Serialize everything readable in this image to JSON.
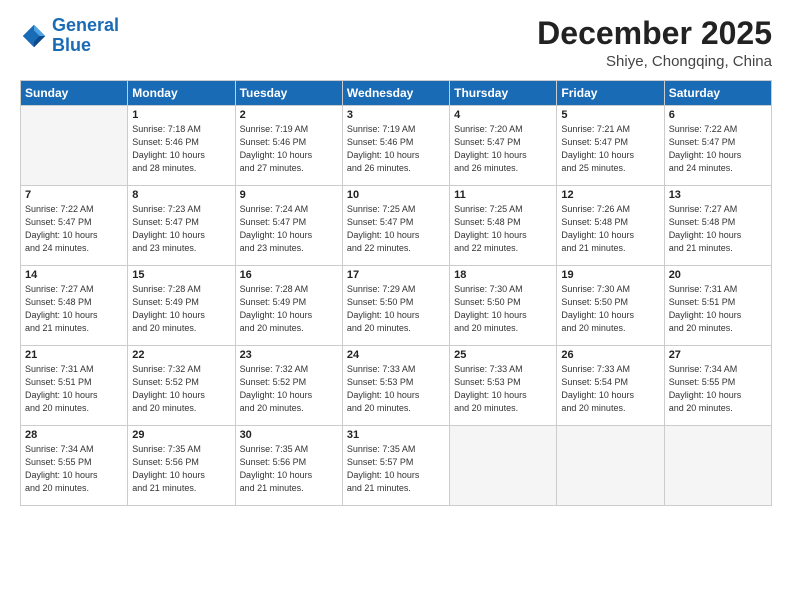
{
  "header": {
    "logo_line1": "General",
    "logo_line2": "Blue",
    "month": "December 2025",
    "location": "Shiye, Chongqing, China"
  },
  "days_of_week": [
    "Sunday",
    "Monday",
    "Tuesday",
    "Wednesday",
    "Thursday",
    "Friday",
    "Saturday"
  ],
  "weeks": [
    [
      {
        "day": "",
        "info": ""
      },
      {
        "day": "1",
        "info": "Sunrise: 7:18 AM\nSunset: 5:46 PM\nDaylight: 10 hours\nand 28 minutes."
      },
      {
        "day": "2",
        "info": "Sunrise: 7:19 AM\nSunset: 5:46 PM\nDaylight: 10 hours\nand 27 minutes."
      },
      {
        "day": "3",
        "info": "Sunrise: 7:19 AM\nSunset: 5:46 PM\nDaylight: 10 hours\nand 26 minutes."
      },
      {
        "day": "4",
        "info": "Sunrise: 7:20 AM\nSunset: 5:47 PM\nDaylight: 10 hours\nand 26 minutes."
      },
      {
        "day": "5",
        "info": "Sunrise: 7:21 AM\nSunset: 5:47 PM\nDaylight: 10 hours\nand 25 minutes."
      },
      {
        "day": "6",
        "info": "Sunrise: 7:22 AM\nSunset: 5:47 PM\nDaylight: 10 hours\nand 24 minutes."
      }
    ],
    [
      {
        "day": "7",
        "info": "Sunrise: 7:22 AM\nSunset: 5:47 PM\nDaylight: 10 hours\nand 24 minutes."
      },
      {
        "day": "8",
        "info": "Sunrise: 7:23 AM\nSunset: 5:47 PM\nDaylight: 10 hours\nand 23 minutes."
      },
      {
        "day": "9",
        "info": "Sunrise: 7:24 AM\nSunset: 5:47 PM\nDaylight: 10 hours\nand 23 minutes."
      },
      {
        "day": "10",
        "info": "Sunrise: 7:25 AM\nSunset: 5:47 PM\nDaylight: 10 hours\nand 22 minutes."
      },
      {
        "day": "11",
        "info": "Sunrise: 7:25 AM\nSunset: 5:48 PM\nDaylight: 10 hours\nand 22 minutes."
      },
      {
        "day": "12",
        "info": "Sunrise: 7:26 AM\nSunset: 5:48 PM\nDaylight: 10 hours\nand 21 minutes."
      },
      {
        "day": "13",
        "info": "Sunrise: 7:27 AM\nSunset: 5:48 PM\nDaylight: 10 hours\nand 21 minutes."
      }
    ],
    [
      {
        "day": "14",
        "info": "Sunrise: 7:27 AM\nSunset: 5:48 PM\nDaylight: 10 hours\nand 21 minutes."
      },
      {
        "day": "15",
        "info": "Sunrise: 7:28 AM\nSunset: 5:49 PM\nDaylight: 10 hours\nand 20 minutes."
      },
      {
        "day": "16",
        "info": "Sunrise: 7:28 AM\nSunset: 5:49 PM\nDaylight: 10 hours\nand 20 minutes."
      },
      {
        "day": "17",
        "info": "Sunrise: 7:29 AM\nSunset: 5:50 PM\nDaylight: 10 hours\nand 20 minutes."
      },
      {
        "day": "18",
        "info": "Sunrise: 7:30 AM\nSunset: 5:50 PM\nDaylight: 10 hours\nand 20 minutes."
      },
      {
        "day": "19",
        "info": "Sunrise: 7:30 AM\nSunset: 5:50 PM\nDaylight: 10 hours\nand 20 minutes."
      },
      {
        "day": "20",
        "info": "Sunrise: 7:31 AM\nSunset: 5:51 PM\nDaylight: 10 hours\nand 20 minutes."
      }
    ],
    [
      {
        "day": "21",
        "info": "Sunrise: 7:31 AM\nSunset: 5:51 PM\nDaylight: 10 hours\nand 20 minutes."
      },
      {
        "day": "22",
        "info": "Sunrise: 7:32 AM\nSunset: 5:52 PM\nDaylight: 10 hours\nand 20 minutes."
      },
      {
        "day": "23",
        "info": "Sunrise: 7:32 AM\nSunset: 5:52 PM\nDaylight: 10 hours\nand 20 minutes."
      },
      {
        "day": "24",
        "info": "Sunrise: 7:33 AM\nSunset: 5:53 PM\nDaylight: 10 hours\nand 20 minutes."
      },
      {
        "day": "25",
        "info": "Sunrise: 7:33 AM\nSunset: 5:53 PM\nDaylight: 10 hours\nand 20 minutes."
      },
      {
        "day": "26",
        "info": "Sunrise: 7:33 AM\nSunset: 5:54 PM\nDaylight: 10 hours\nand 20 minutes."
      },
      {
        "day": "27",
        "info": "Sunrise: 7:34 AM\nSunset: 5:55 PM\nDaylight: 10 hours\nand 20 minutes."
      }
    ],
    [
      {
        "day": "28",
        "info": "Sunrise: 7:34 AM\nSunset: 5:55 PM\nDaylight: 10 hours\nand 20 minutes."
      },
      {
        "day": "29",
        "info": "Sunrise: 7:35 AM\nSunset: 5:56 PM\nDaylight: 10 hours\nand 21 minutes."
      },
      {
        "day": "30",
        "info": "Sunrise: 7:35 AM\nSunset: 5:56 PM\nDaylight: 10 hours\nand 21 minutes."
      },
      {
        "day": "31",
        "info": "Sunrise: 7:35 AM\nSunset: 5:57 PM\nDaylight: 10 hours\nand 21 minutes."
      },
      {
        "day": "",
        "info": ""
      },
      {
        "day": "",
        "info": ""
      },
      {
        "day": "",
        "info": ""
      }
    ]
  ]
}
